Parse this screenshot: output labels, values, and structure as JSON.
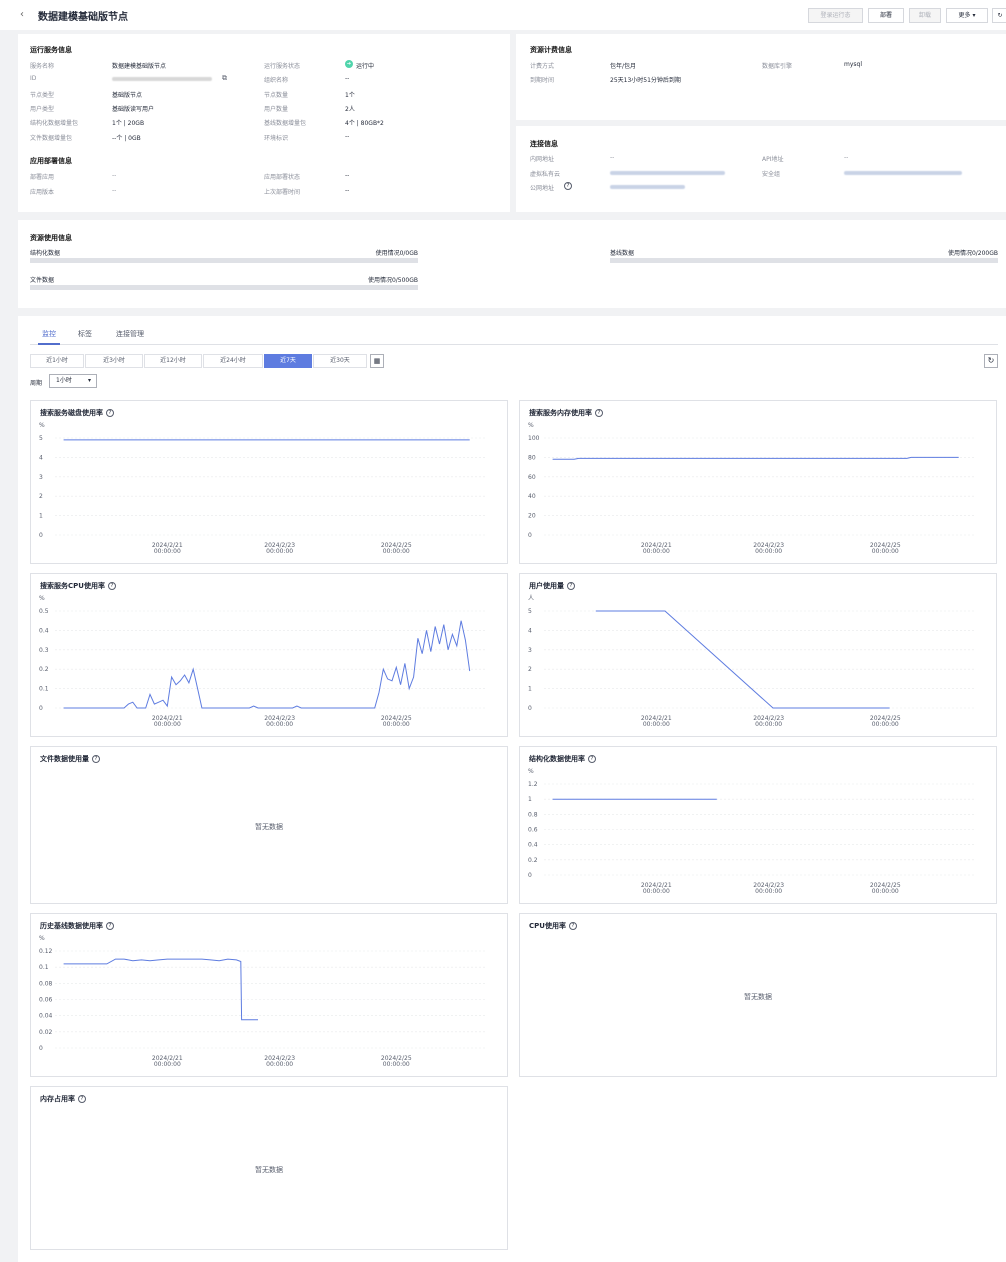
{
  "header": {
    "back_icon": "chevron-left-icon",
    "title": "数据建模基础版节点",
    "buttons": {
      "dis1": "登录运行态",
      "deploy": "部署",
      "dis2": "卸载",
      "more": "更多"
    }
  },
  "run_info": {
    "title": "运行服务信息",
    "rows": [
      {
        "l1": "服务名称",
        "v1": "数据建模基础版节点",
        "l2": "运行服务状态",
        "v2": "运行中"
      },
      {
        "l1": "ID",
        "v1": "",
        "l2": "组织名称",
        "v2": "--"
      },
      {
        "l1": "节点类型",
        "v1": "基础版节点",
        "l2": "节点数量",
        "v2": "1个"
      },
      {
        "l1": "用户类型",
        "v1": "基础版读写用户",
        "l2": "用户数量",
        "v2": "2人"
      },
      {
        "l1": "结构化数据增量包",
        "v1": "1个 | 20GB",
        "l2": "基线数据增量包",
        "v2": "4个 | 80GB*2"
      },
      {
        "l1": "文件数据增量包",
        "v1": "--个 | 0GB",
        "l2": "环境标识",
        "v2": "--"
      }
    ]
  },
  "app_info": {
    "title": "应用部署信息",
    "rows": [
      {
        "l1": "部署应用",
        "v1": "--",
        "l2": "应用部署状态",
        "v2": "--"
      },
      {
        "l1": "应用版本",
        "v1": "--",
        "l2": "上次部署时间",
        "v2": "--"
      }
    ]
  },
  "billing": {
    "title": "资源计费信息",
    "rows": [
      {
        "l1": "计费方式",
        "v1": "包年/包月",
        "l2": "数据库引擎",
        "v2": "mysql"
      },
      {
        "l1": "到期时间",
        "v1": "25天13小时51分钟后到期"
      }
    ]
  },
  "connection": {
    "title": "连接信息",
    "rows": [
      {
        "l1": "内网地址",
        "v1": "--",
        "l2": "API地址",
        "v2": "--"
      },
      {
        "l1": "虚拟私有云",
        "l2": "安全组"
      },
      {
        "l1": "公网地址"
      }
    ]
  },
  "usage": {
    "title": "资源使用信息",
    "items": [
      {
        "label": "结构化数据",
        "value": "使用情况0/0GB",
        "fraction": 0
      },
      {
        "label": "基线数据",
        "value": "使用情况0/200GB",
        "fraction": 0
      },
      {
        "label": "文件数据",
        "value": "使用情况0/500GB",
        "fraction": 0
      }
    ]
  },
  "tabs": [
    "监控",
    "标签",
    "连接管理"
  ],
  "ranges": [
    "近1小时",
    "近3小时",
    "近12小时",
    "近24小时",
    "近7天",
    "近30天"
  ],
  "active_range": "近7天",
  "period": {
    "label": "周期",
    "value": "1小时"
  },
  "no_data": "暂无数据",
  "chart_data": [
    {
      "type": "line",
      "title": "搜索服务磁盘使用率",
      "unit": "%",
      "yticks": [
        "5",
        "4",
        "3",
        "2",
        "1",
        "0"
      ],
      "ylim": [
        0,
        5
      ],
      "xticks": [
        "2024/2/21 00:00:00",
        "2024/2/23 00:00:00",
        "2024/2/25 00:00:00"
      ],
      "x": [
        2,
        96
      ],
      "values": [
        4.9,
        4.9
      ]
    },
    {
      "type": "line",
      "title": "搜索服务内存使用率",
      "unit": "%",
      "yticks": [
        "100",
        "80",
        "60",
        "40",
        "20",
        "0"
      ],
      "ylim": [
        0,
        100
      ],
      "xticks": [
        "2024/2/21 00:00:00",
        "2024/2/23 00:00:00",
        "2024/2/25 00:00:00"
      ],
      "x": [
        2,
        7,
        8,
        84,
        85,
        96
      ],
      "values": [
        78,
        78,
        79,
        79,
        80,
        80
      ]
    },
    {
      "type": "line",
      "title": "搜索服务CPU使用率",
      "unit": "%",
      "yticks": [
        "0.5",
        "0.4",
        "0.3",
        "0.2",
        "0.1",
        "0"
      ],
      "ylim": [
        0,
        0.5
      ],
      "xticks": [
        "2024/2/21 00:00:00",
        "2024/2/23 00:00:00",
        "2024/2/25 00:00:00"
      ],
      "x": [
        2,
        16,
        17,
        18,
        19,
        20,
        21,
        22,
        23,
        24,
        25,
        26,
        27,
        28,
        29,
        30,
        31,
        32,
        33,
        34,
        35,
        36,
        37,
        38,
        39,
        40,
        45,
        46,
        47,
        48,
        55,
        56,
        57,
        58,
        74,
        75,
        76,
        77,
        78,
        79,
        80,
        81,
        82,
        83,
        84,
        85,
        86,
        87,
        88,
        89,
        90,
        91,
        92,
        93,
        94,
        95,
        96
      ],
      "values": [
        0,
        0,
        0.02,
        0.03,
        0,
        0,
        0,
        0.07,
        0.02,
        0.03,
        0.04,
        0.01,
        0.16,
        0.12,
        0.14,
        0.17,
        0.13,
        0.2,
        0.1,
        0.0,
        0,
        0,
        0,
        0,
        0,
        0,
        0,
        0.01,
        0,
        0,
        0,
        0.01,
        0,
        0,
        0,
        0.08,
        0.2,
        0.15,
        0.14,
        0.21,
        0.12,
        0.23,
        0.1,
        0.16,
        0.36,
        0.28,
        0.4,
        0.29,
        0.42,
        0.33,
        0.43,
        0.3,
        0.38,
        0.32,
        0.45,
        0.35,
        0.19
      ]
    },
    {
      "type": "line",
      "title": "用户使用量",
      "unit": "人",
      "yticks": [
        "5",
        "4",
        "3",
        "2",
        "1",
        "0"
      ],
      "ylim": [
        0,
        5
      ],
      "xticks": [
        "2024/2/21 00:00:00",
        "2024/2/23 00:00:00",
        "2024/2/25 00:00:00"
      ],
      "x": [
        12,
        28,
        53,
        80
      ],
      "values": [
        5,
        5,
        0,
        0
      ]
    },
    {
      "type": "empty",
      "title": "文件数据使用量"
    },
    {
      "type": "line",
      "title": "结构化数据使用率",
      "unit": "%",
      "yticks": [
        "1.2",
        "1",
        "0.8",
        "0.6",
        "0.4",
        "0.2",
        "0"
      ],
      "ylim": [
        0,
        1.2
      ],
      "xticks": [
        "2024/2/21 00:00:00",
        "2024/2/23 00:00:00",
        "2024/2/25 00:00:00"
      ],
      "x": [
        2,
        40
      ],
      "values": [
        1,
        1
      ]
    },
    {
      "type": "line",
      "title": "历史基线数据使用率",
      "unit": "%",
      "yticks": [
        "0.12",
        "0.1",
        "0.08",
        "0.06",
        "0.04",
        "0.02",
        "0"
      ],
      "ylim": [
        0,
        0.12
      ],
      "xticks": [
        "2024/2/21 00:00:00",
        "2024/2/23 00:00:00",
        "2024/2/25 00:00:00"
      ],
      "x": [
        2,
        12,
        14,
        16,
        18,
        20,
        22,
        24,
        26,
        28,
        30,
        32,
        34,
        36,
        38,
        40,
        42,
        43,
        43.2,
        47
      ],
      "values": [
        0.104,
        0.104,
        0.11,
        0.11,
        0.108,
        0.109,
        0.108,
        0.109,
        0.11,
        0.11,
        0.11,
        0.11,
        0.11,
        0.109,
        0.108,
        0.11,
        0.109,
        0.107,
        0.035,
        0.035
      ]
    },
    {
      "type": "empty",
      "title": "CPU使用率"
    },
    {
      "type": "empty",
      "title": "内存占用率"
    }
  ]
}
